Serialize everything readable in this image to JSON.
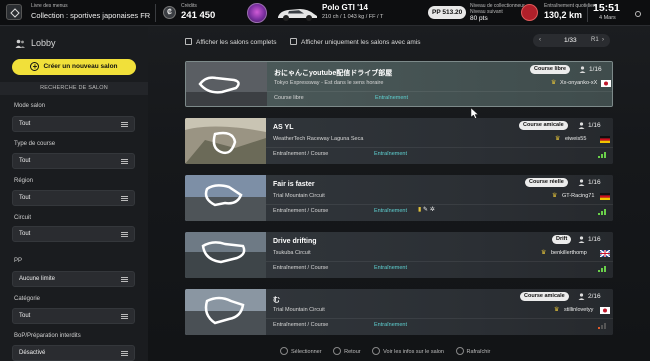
{
  "topbar": {
    "menu_label": "Livre des menus",
    "collection": "Collection : sportives japonaises FR",
    "credits_label": "Crédits",
    "credits_icon": "credit-icon",
    "credits_value": "241 450",
    "car_model": "Polo GTI '14",
    "car_spec": "210 ch / 1 043 kg / FF / T",
    "pp": "PP 513.20",
    "collector_label": "Niveau de collectionneur",
    "collector_sub": "Niveau suivant",
    "collector_value": "80 pts",
    "dist_label": "Entraînement quotidien",
    "dist_value": "130,2 km",
    "time": "15:51",
    "date": "4 Mars"
  },
  "sidebar": {
    "title": "Lobby",
    "create_button": "Créer un nouveau salon",
    "search_header": "RECHERCHE DE SALON",
    "filters": [
      {
        "label": "Mode salon",
        "value": "Tout"
      },
      {
        "label": "Type de course",
        "value": "Tout"
      },
      {
        "label": "Région",
        "value": "Tout"
      },
      {
        "label": "Circuit",
        "value": "Tout"
      },
      {
        "label": "PP",
        "value": "Aucune limite"
      },
      {
        "label": "Catégorie",
        "value": "Tout"
      },
      {
        "label": "BoP/Préparation interdits",
        "value": "Désactivé"
      }
    ]
  },
  "main": {
    "opt_full": "Afficher les salons complets",
    "opt_friends": "Afficher uniquement les salons avec amis",
    "page": "1/33",
    "r1": "R1",
    "rooms": [
      {
        "name": "おにゃんこyoutube配信ドライブ部屋",
        "track": "Tokyo Expressway - Est dans le sens horaire",
        "type": "Course libre",
        "mode": "Entraînement",
        "badge": "Course libre",
        "players": "1/16",
        "host": "Xx-onyanko-xX",
        "flag": "jp"
      },
      {
        "name": "AS YL",
        "track": "WeatherTech Raceway Laguna Seca",
        "type": "Entraînement / Course",
        "mode": "Entraînement",
        "badge": "Course amicale",
        "players": "1/16",
        "host": "eiweis55",
        "flag": "de"
      },
      {
        "name": "Fair is faster",
        "track": "Trial Mountain Circuit",
        "type": "Entraînement / Course",
        "mode": "Entraînement",
        "badge": "Course réelle",
        "players": "1/16",
        "host": "GT-Racing71",
        "flag": "de"
      },
      {
        "name": "Drive drifting",
        "track": "Tsukuba Circuit",
        "type": "Entraînement / Course",
        "mode": "Entraînement",
        "badge": "Drift",
        "players": "1/16",
        "host": "benkillerthomp",
        "flag": "gb"
      },
      {
        "name": "む",
        "track": "Trial Mountain Circuit",
        "type": "Entraînement / Course",
        "mode": "Entraînement",
        "badge": "Course amicale",
        "players": "2/16",
        "host": "stillinlovetyy",
        "flag": "jp"
      }
    ]
  },
  "hints": {
    "select": "Sélectionner",
    "back": "Retour",
    "info": "Voir les infos sur le salon",
    "refresh": "Rafraîchir"
  }
}
